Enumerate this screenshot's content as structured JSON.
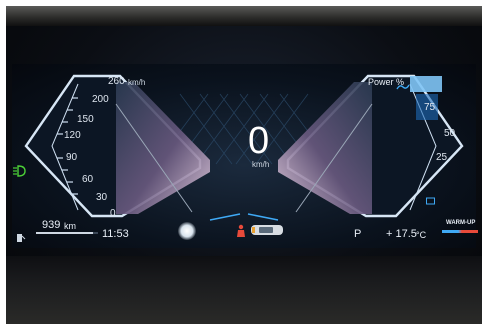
{
  "speedometer": {
    "max_label": "260",
    "max_unit": "km/h",
    "ticks": [
      "200",
      "150",
      "120",
      "90",
      "60",
      "30",
      "0"
    ],
    "current_speed": "0",
    "speed_unit": "km/h"
  },
  "power_gauge": {
    "title": "Power %",
    "ticks": [
      "75",
      "50",
      "25"
    ]
  },
  "status_bar": {
    "range_value": "939",
    "range_unit": "km",
    "clock": "11:53",
    "gear": "P",
    "temperature": "+ 17.5",
    "temperature_unit": "°C",
    "warmup_label": "WARM-UP"
  },
  "icons": {
    "left_indicator": "headlight-icon",
    "fuel": "fuel-pump-icon",
    "seatbelt": "seatbelt-warning-icon",
    "car": "car-top-view-icon",
    "eco": "eco-mode-icon"
  },
  "colors": {
    "accent_blue": "#3fa9f5",
    "indicator_green": "#4cd137",
    "warning_red": "#e84a3a"
  }
}
